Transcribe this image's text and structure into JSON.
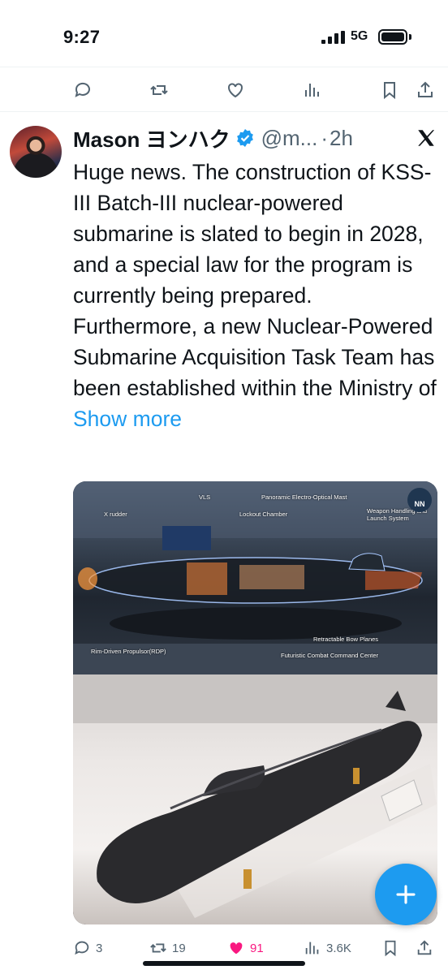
{
  "status_bar": {
    "time": "9:27",
    "network": "5G"
  },
  "tweet": {
    "display_name": "Mason ヨンハク",
    "handle": "@m...",
    "separator": "·",
    "time": "2h",
    "text": "Huge news. The construction of KSS-III Batch-III nuclear-powered submarine is slated to begin in 2028, and a special law for the program is currently being prepared. Furthermore, a new Nuclear-Powered Submarine Acquisition Task Team has been established within the Ministry of ",
    "show_more": "Show more",
    "media": {
      "labels": {
        "vls": "VLS",
        "mast": "Panoramic Electro-Optical Mast",
        "x_rudder": "X rudder",
        "lockout": "Lockout Chamber",
        "weapon": "Weapon Handling and Launch System",
        "bow_planes": "Retractable Bow Planes",
        "propulsor": "Rim-Driven Propulsor(RDP)",
        "command": "Futuristic Combat Command Center"
      },
      "badge": "NN"
    }
  },
  "actions": {
    "replies": "3",
    "reposts": "19",
    "likes": "91",
    "views": "3.6K"
  },
  "colors": {
    "accent": "#1d9bf0",
    "like": "#f91880",
    "secondary": "#536471"
  },
  "icons": [
    "reply-icon",
    "repost-icon",
    "like-icon",
    "views-icon",
    "bookmark-icon",
    "share-icon",
    "verified-icon",
    "x-logo-icon",
    "compose-icon"
  ]
}
